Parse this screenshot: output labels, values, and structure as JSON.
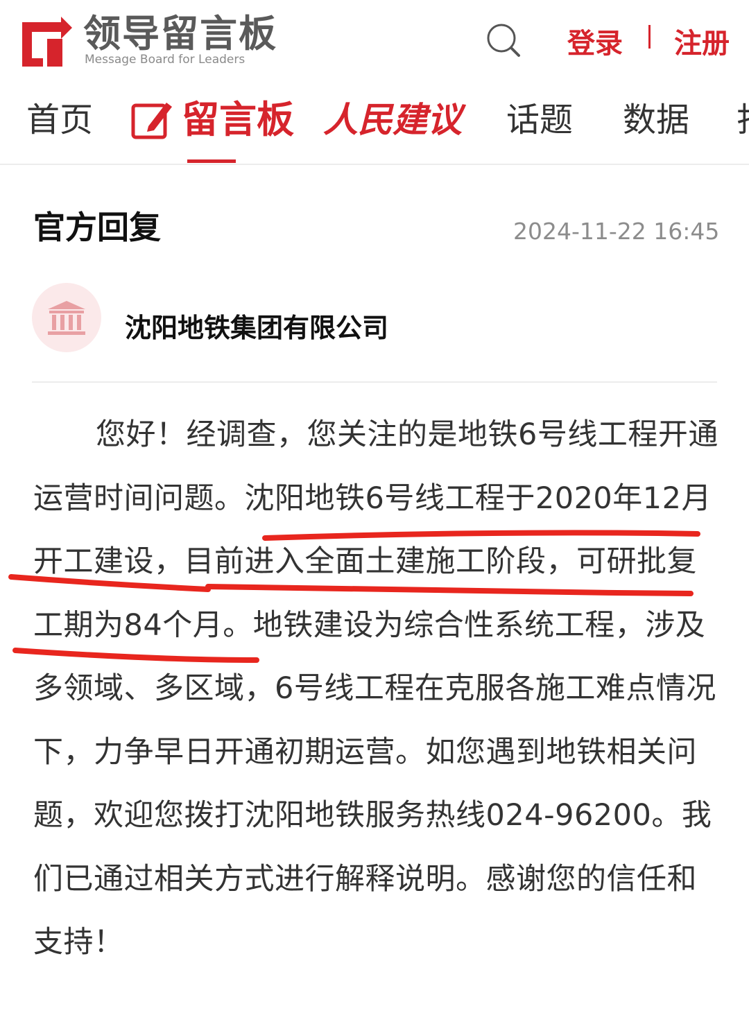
{
  "header": {
    "logo_title": "领导留言板",
    "logo_subtitle": "Message Board for Leaders",
    "login_label": "登录",
    "register_label": "注册"
  },
  "nav": {
    "items": [
      {
        "label": "首页"
      },
      {
        "label": "留言板"
      },
      {
        "label": "人民建议"
      },
      {
        "label": "话题"
      },
      {
        "label": "数据"
      },
      {
        "label": "打"
      }
    ]
  },
  "reply": {
    "heading": "官方回复",
    "timestamp": "2024-11-22 16:45",
    "organization": "沈阳地铁集团有限公司",
    "body": "您好！经调查，您关注的是地铁6号线工程开通运营时间问题。沈阳地铁6号线工程于2020年12月开工建设，目前进入全面土建施工阶段，可研批复工期为84个月。地铁建设为综合性系统工程，涉及多领域、多区域，6号线工程在克服各施工难点情况下，力争早日开通初期运营。如您遇到地铁相关问题，欢迎您拨打沈阳地铁服务热线024-96200。我们已通过相关方式进行解释说明。感谢您的信任和支持！"
  },
  "colors": {
    "brand_red": "#d6242c",
    "annotation_red": "#e8261e"
  }
}
